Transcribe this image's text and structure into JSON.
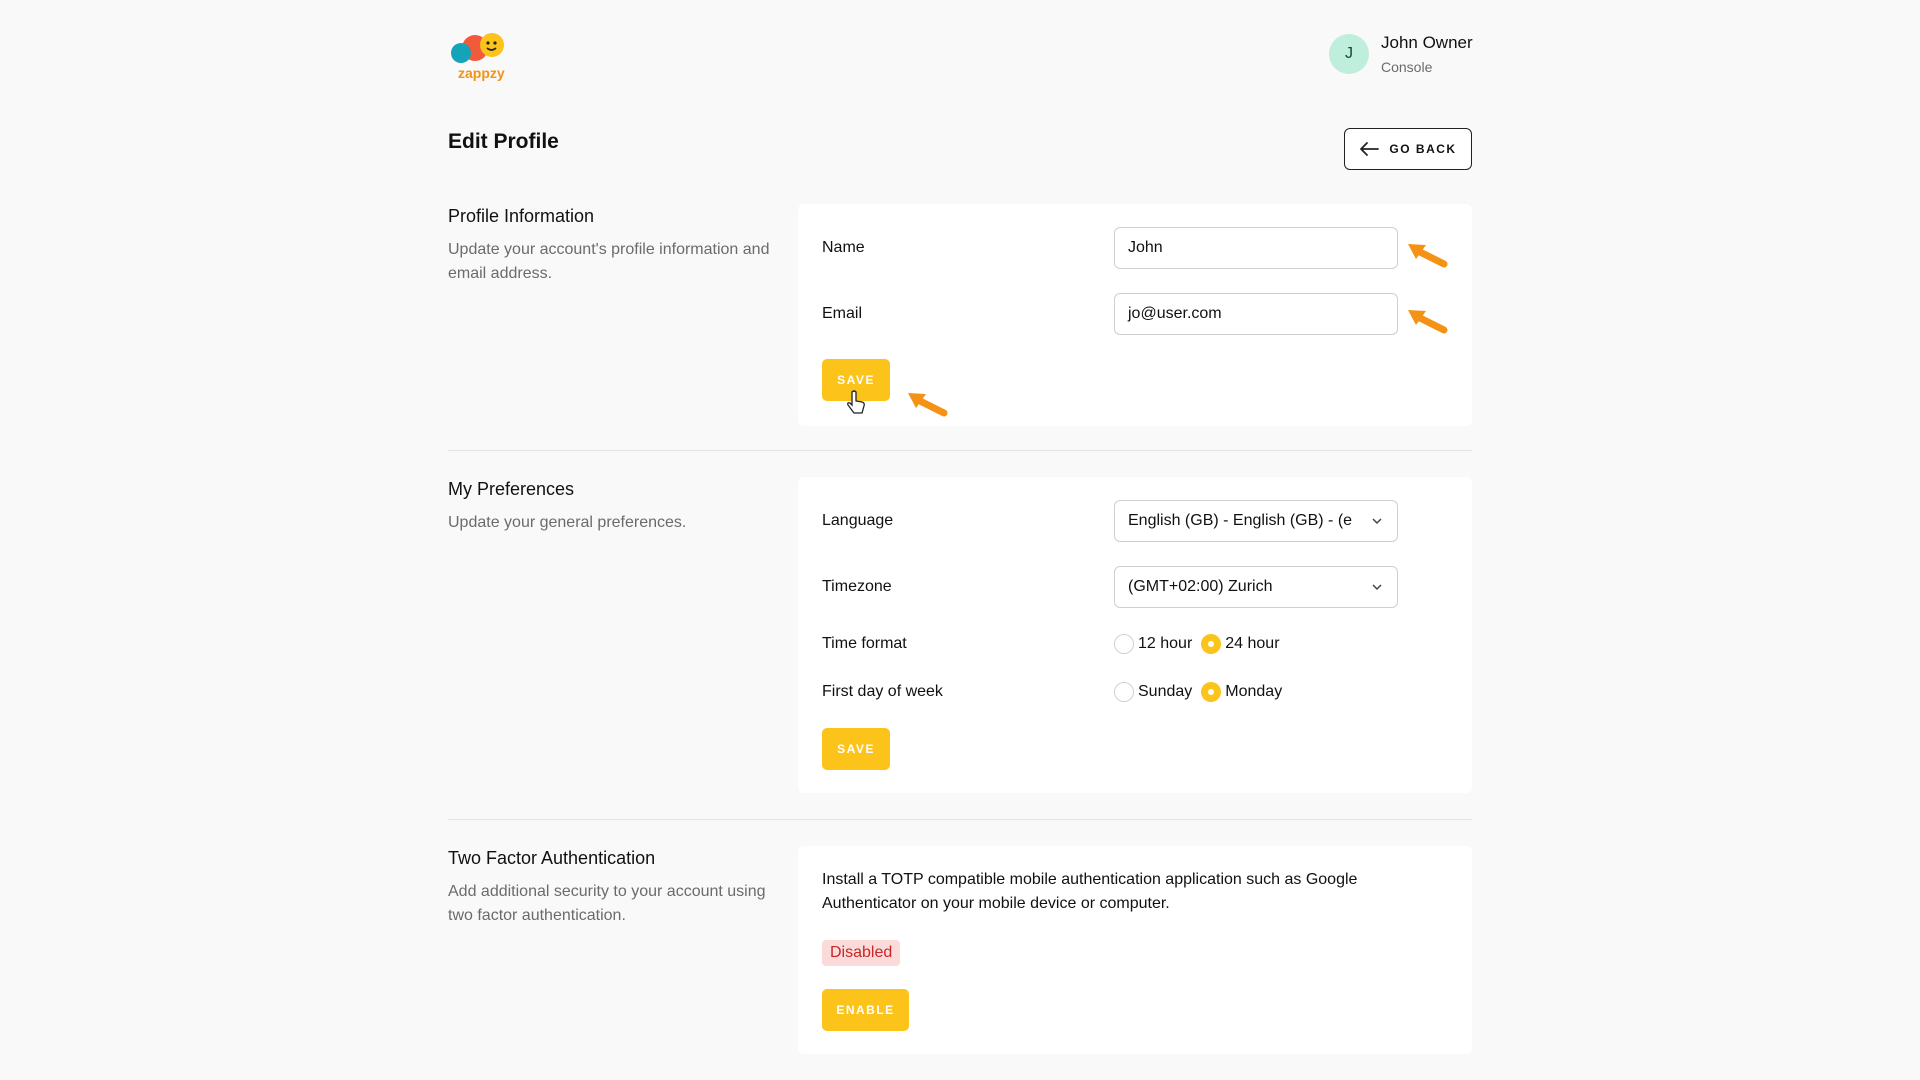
{
  "header": {
    "logo_text": "zappzy",
    "user": {
      "initial": "J",
      "name": "John Owner",
      "role": "Console"
    }
  },
  "page": {
    "title": "Edit Profile",
    "go_back_label": "GO BACK"
  },
  "profile": {
    "title": "Profile Information",
    "description": "Update your account's profile information and email address.",
    "name_label": "Name",
    "name_value": "John",
    "email_label": "Email",
    "email_value": "jo@user.com",
    "save_label": "SAVE"
  },
  "preferences": {
    "title": "My Preferences",
    "description": "Update your general preferences.",
    "language_label": "Language",
    "language_value": "English (GB) - English (GB) - (e",
    "timezone_label": "Timezone",
    "timezone_value": "(GMT+02:00) Zurich",
    "time_format_label": "Time format",
    "time_format_options": [
      "12 hour",
      "24 hour"
    ],
    "time_format_selected": "24 hour",
    "first_day_label": "First day of week",
    "first_day_options": [
      "Sunday",
      "Monday"
    ],
    "first_day_selected": "Monday",
    "save_label": "SAVE"
  },
  "two_factor": {
    "title": "Two Factor Authentication",
    "description": "Add additional security to your account using two factor authentication.",
    "info": "Install a TOTP compatible mobile authentication application such as Google Authenticator on your mobile device or computer.",
    "status": "Disabled",
    "enable_label": "ENABLE"
  },
  "colors": {
    "accent": "#fcc31b",
    "annotation_arrow": "#f39214",
    "status_disabled_bg": "#fbdada",
    "status_disabled_text": "#c62828"
  }
}
